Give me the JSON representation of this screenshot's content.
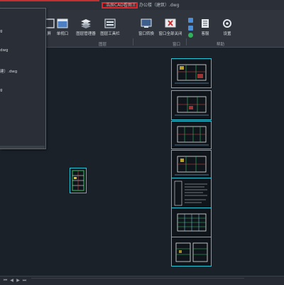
{
  "window": {
    "app_title": "浩辰CAD看图王",
    "doc_title": "办公楼（建筑）.dwg"
  },
  "ribbon": {
    "buttons": [
      {
        "label": "屏"
      },
      {
        "label": "单视口"
      },
      {
        "label": "图层管理器"
      },
      {
        "label": "图层工具栏"
      },
      {
        "label": "窗口转换"
      },
      {
        "label": "窗口全部关闭"
      },
      {
        "label": "客服"
      },
      {
        "label": "设置"
      }
    ],
    "groups": {
      "layers": "图层",
      "window": "窗口",
      "help": "帮助"
    }
  },
  "file_panel": {
    "items": [
      "g",
      "dwg",
      "建）.dwg",
      "g"
    ]
  },
  "colors": {
    "accent_red": "#e0262b",
    "sheet_border": "#25c7d8",
    "canvas_bg": "#1b2129"
  }
}
